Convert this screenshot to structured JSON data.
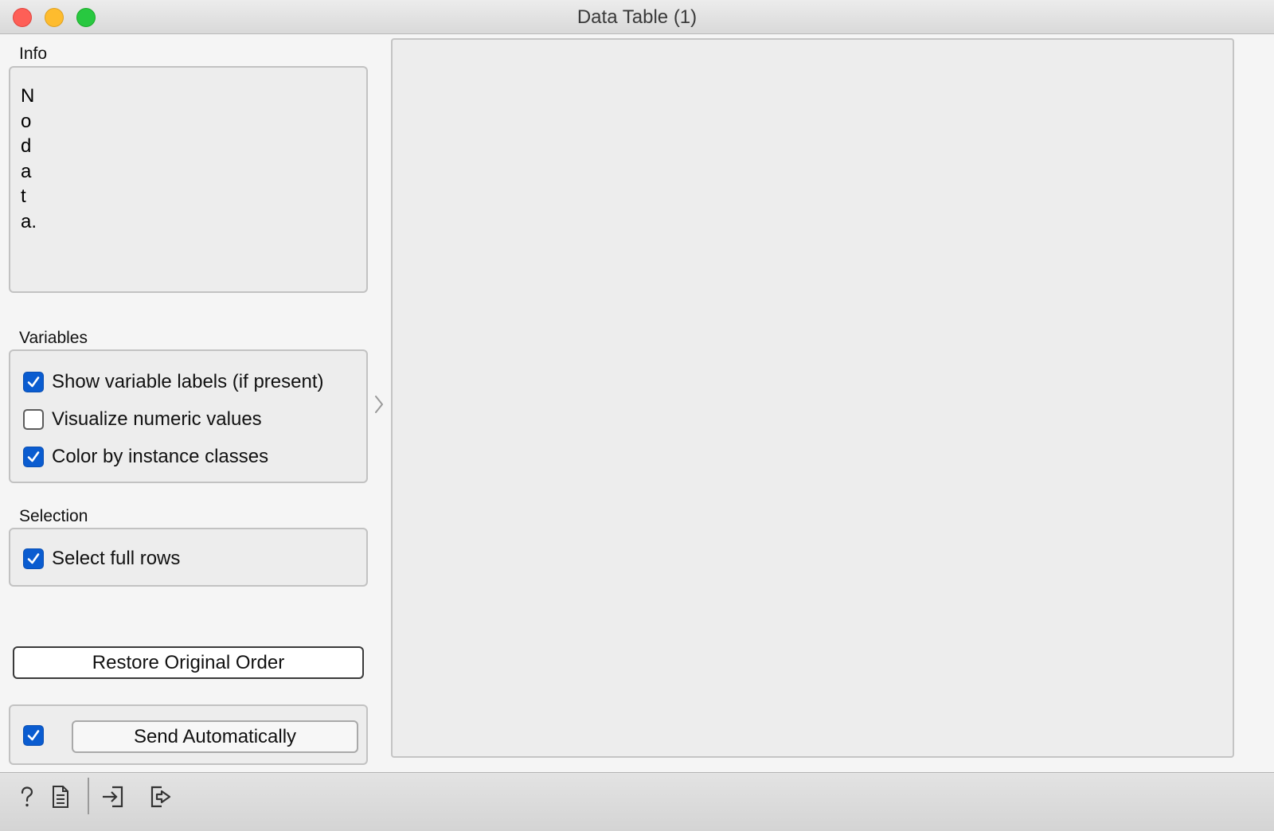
{
  "window": {
    "title": "Data Table (1)"
  },
  "info": {
    "label": "Info",
    "text": "No data."
  },
  "variables": {
    "label": "Variables",
    "show_labels": {
      "label": "Show variable labels (if present)",
      "checked": true
    },
    "visualize_numeric": {
      "label": "Visualize numeric values",
      "checked": false
    },
    "color_by_class": {
      "label": "Color by instance classes",
      "checked": true
    }
  },
  "selection": {
    "label": "Selection",
    "select_full_rows": {
      "label": "Select full rows",
      "checked": true
    }
  },
  "restore_button": {
    "label": "Restore Original Order"
  },
  "send": {
    "auto_checked": true,
    "button_label": "Send Automatically"
  },
  "statusbar": {
    "icons": [
      "help-icon",
      "report-icon",
      "input-icon",
      "output-icon"
    ]
  },
  "colors": {
    "accent": "#0a5cd0",
    "close": "#fe5f57",
    "minimize": "#febc2e",
    "maximize": "#28c840"
  }
}
